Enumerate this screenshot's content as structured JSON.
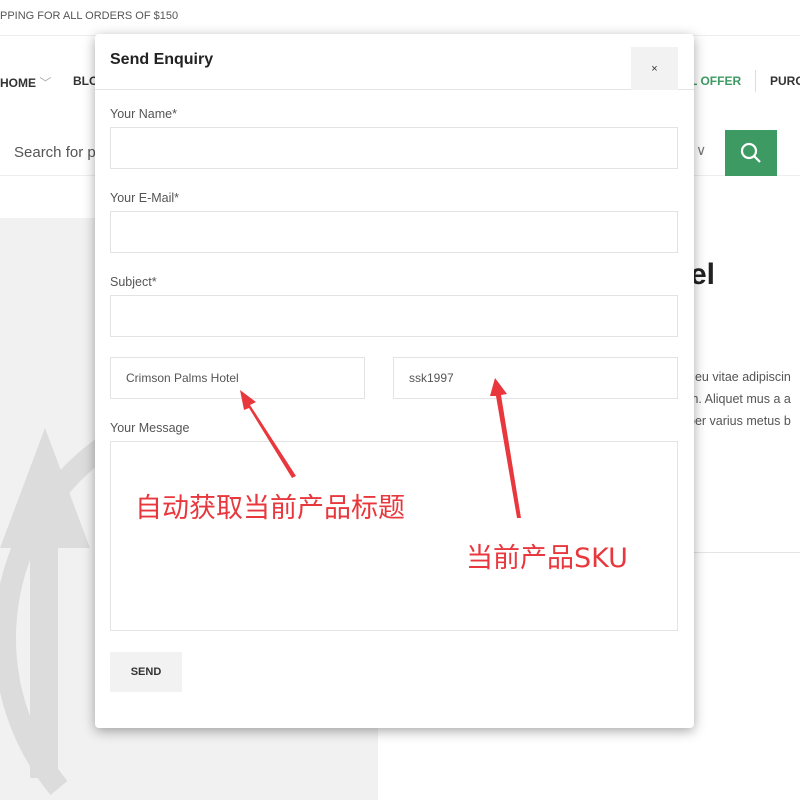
{
  "topbar": {
    "text": "PPING FOR ALL ORDERS OF $150"
  },
  "nav": {
    "items": [
      "HOME",
      "BLO",
      "L OFFER",
      "PURC"
    ]
  },
  "search": {
    "placeholder": "Search for pr"
  },
  "product": {
    "title_fragment": "el",
    "desc": [
      "t eu vitae adipiscin",
      "m. Aliquet mus a a",
      "per varius metus b"
    ]
  },
  "modal": {
    "title": "Send Enquiry",
    "close": "×",
    "fields": {
      "name_label": "Your Name*",
      "email_label": "Your E-Mail*",
      "subject_label": "Subject*",
      "product_value": "Crimson Palms Hotel",
      "sku_value": "ssk1997",
      "message_label": "Your Message"
    },
    "send": "SEND"
  },
  "annotations": {
    "title_note": "自动获取当前产品标题",
    "sku_note": "当前产品SKU"
  },
  "colors": {
    "accent": "#3e9a63",
    "annotation": "#e8383d"
  }
}
